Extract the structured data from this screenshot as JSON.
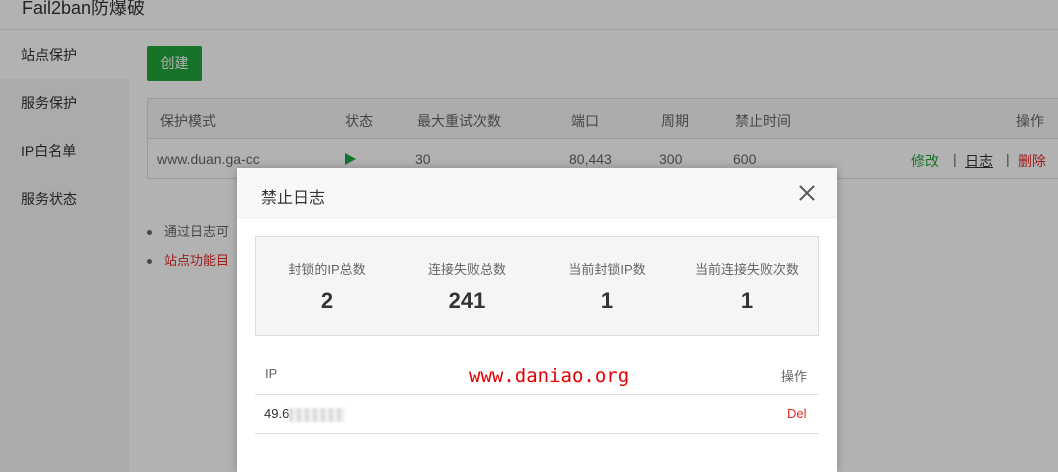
{
  "app": {
    "title": "Fail2ban防爆破"
  },
  "sidebar": {
    "items": [
      {
        "label": "站点保护",
        "active": true
      },
      {
        "label": "服务保护",
        "active": false
      },
      {
        "label": "IP白名单",
        "active": false
      },
      {
        "label": "服务状态",
        "active": false
      }
    ]
  },
  "main": {
    "create_label": "创建",
    "table": {
      "headers": [
        "保护模式",
        "状态",
        "最大重试次数",
        "端口",
        "周期",
        "禁止时间",
        "操作"
      ],
      "rows": [
        {
          "mode": "www.duan.ga-cc",
          "status": "play-icon",
          "max_retry": "30",
          "ports": "80,443",
          "period": "300",
          "ban_time": "600",
          "actions": {
            "edit": "修改",
            "sep1": "|",
            "log": "日志",
            "sep2": "|",
            "delete": "删除"
          }
        }
      ]
    },
    "notes": [
      {
        "text": "通过日志可",
        "color": "#666666"
      },
      {
        "text": "站点功能目",
        "color": "#e52929"
      }
    ]
  },
  "modal": {
    "title": "禁止日志",
    "stats": [
      {
        "label": "封锁的IP总数",
        "value": "2"
      },
      {
        "label": "连接失败总数",
        "value": "241"
      },
      {
        "label": "当前封锁IP数",
        "value": "1"
      },
      {
        "label": "当前连接失败次数",
        "value": "1"
      }
    ],
    "ip_table": {
      "headers": {
        "ip": "IP",
        "action": "操作"
      },
      "rows": [
        {
          "ip": "49.6",
          "action": "Del"
        }
      ]
    },
    "watermark": "www.daniao.org"
  },
  "colors": {
    "accent": "#20a53a",
    "danger": "#e52929",
    "watermark": "#e00000"
  }
}
